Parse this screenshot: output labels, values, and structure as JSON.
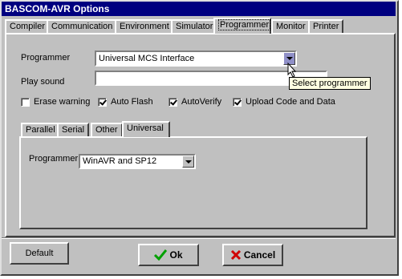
{
  "window": {
    "title": "BASCOM-AVR Options"
  },
  "tabs": [
    {
      "label": "Compiler"
    },
    {
      "label": "Communication"
    },
    {
      "label": "Environment"
    },
    {
      "label": "Simulator"
    },
    {
      "label": "Programmer"
    },
    {
      "label": "Monitor"
    },
    {
      "label": "Printer"
    }
  ],
  "programmer": {
    "label": "Programmer",
    "value": "Universal MCS Interface",
    "tooltip": "Select programmer"
  },
  "play_sound": {
    "label": "Play sound",
    "value": ""
  },
  "checkboxes": [
    {
      "label": "Erase warning",
      "checked": false
    },
    {
      "label": "Auto Flash",
      "checked": true
    },
    {
      "label": "AutoVerify",
      "checked": true
    },
    {
      "label": "Upload Code and Data",
      "checked": true
    }
  ],
  "inner_tabs": [
    {
      "label": "Parallel"
    },
    {
      "label": "Serial"
    },
    {
      "label": "Other"
    },
    {
      "label": "Universal"
    }
  ],
  "universal": {
    "programmer_label": "Programmer",
    "programmer_value": "WinAVR and SP12"
  },
  "buttons": {
    "default": "Default",
    "ok": "Ok",
    "cancel": "Cancel"
  },
  "colors": {
    "titlebar": "#000080",
    "face": "#c0c0c0",
    "ok_check": "#00a000",
    "cancel_x": "#d00000"
  }
}
